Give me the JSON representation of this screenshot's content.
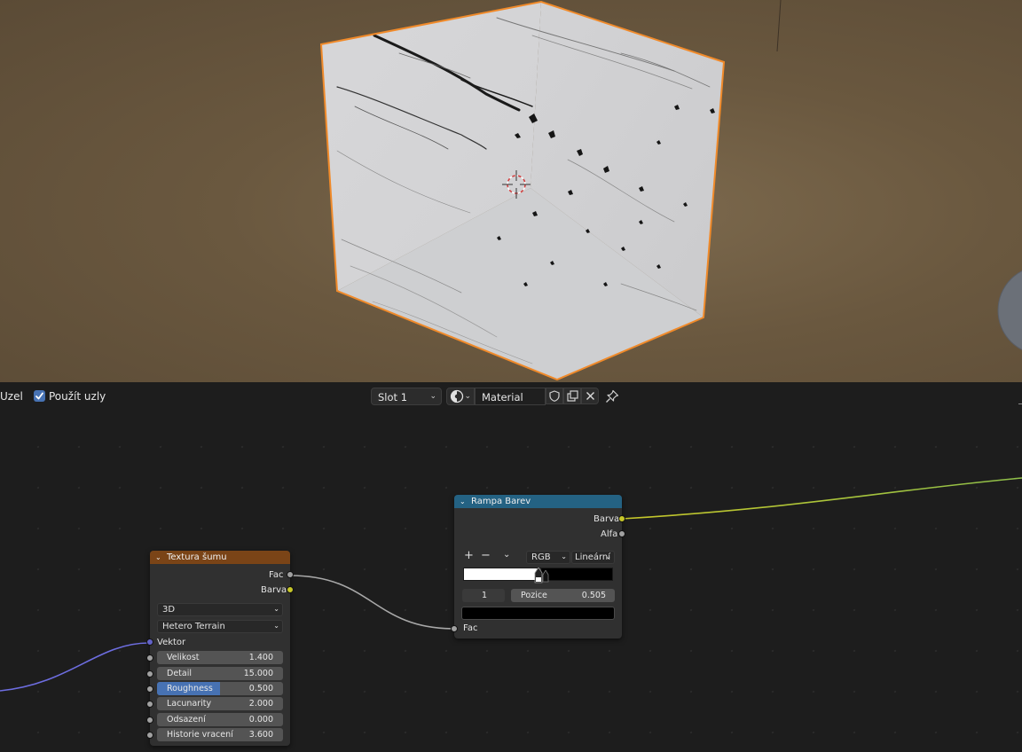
{
  "header": {
    "editor_label": "Uzel",
    "use_nodes_label": "Použít uzly",
    "use_nodes_checked": true,
    "slot": "Slot 1",
    "material_name": "Material"
  },
  "nodes": {
    "noise": {
      "title": "Textura šumu",
      "title_color": "#7a4417",
      "outputs": [
        "Fac",
        "Barva"
      ],
      "dimensions": "3D",
      "type": "Hetero Terrain",
      "vector_label": "Vektor",
      "fields": [
        {
          "label": "Velikost",
          "value": "1.400"
        },
        {
          "label": "Detail",
          "value": "15.000"
        },
        {
          "label": "Roughness",
          "value": "0.500",
          "fill": 0.5
        },
        {
          "label": "Lacunarity",
          "value": "2.000"
        },
        {
          "label": "Odsazení",
          "value": "0.000"
        },
        {
          "label": "Historie vracení",
          "value": "3.600"
        }
      ]
    },
    "ramp": {
      "title": "Rampa Barev",
      "title_color": "#246283",
      "outputs": [
        "Barva",
        "Alfa"
      ],
      "color_mode": "RGB",
      "interpolation": "Lineární",
      "stop_index": "1",
      "position_label": "Pozice",
      "position_value": "0.505",
      "stop_color": "#000000",
      "input_label": "Fac"
    }
  },
  "colors": {
    "selection_outline": "#f08a2a",
    "accent_blue": "#4772b3"
  }
}
